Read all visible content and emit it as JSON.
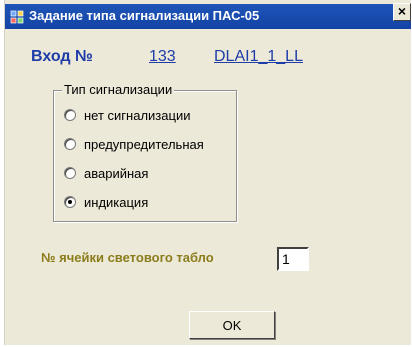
{
  "window": {
    "title": "Задание типа сигнализации ПАС-05",
    "close_label": "×"
  },
  "input": {
    "label": "Вход №",
    "number": "133",
    "name": "DLAI1_1_LL"
  },
  "signal_type": {
    "legend": "Тип сигнализации",
    "options": [
      {
        "label": "нет сигнализации",
        "checked": false
      },
      {
        "label": "предупредительная",
        "checked": false
      },
      {
        "label": "аварийная",
        "checked": false
      },
      {
        "label": "индикация",
        "checked": true
      }
    ]
  },
  "cell": {
    "label": "№ ячейки светового табло",
    "value": "1"
  },
  "buttons": {
    "ok_label": "OK"
  },
  "colors": {
    "title_bar": "#1f55b8",
    "link": "#1e3ca8",
    "cell_label": "#8c7d1c",
    "window_bg": "#ece9d8"
  }
}
